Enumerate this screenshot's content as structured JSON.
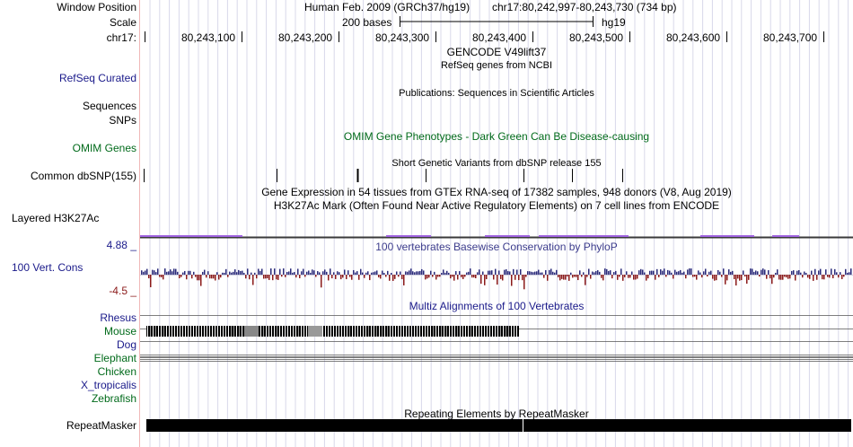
{
  "header": {
    "window_position_label": "Window Position",
    "scale_label": "Scale",
    "chrom_label": "chr17:",
    "assembly_text": "Human Feb. 2009 (GRCh37/hg19)",
    "position_text": "chr17:80,242,997-80,243,730 (734 bp)",
    "scale_text": "200 bases",
    "scale_db": "hg19",
    "coord_ticks": [
      "80,243,100",
      "80,243,200",
      "80,243,300",
      "80,243,400",
      "80,243,500",
      "80,243,600",
      "80,243,700"
    ]
  },
  "tracks": {
    "gencode_title": "GENCODE V49lift37",
    "refseq_subtitle": "RefSeq genes from NCBI",
    "refseq_label": "RefSeq Curated",
    "publications_title": "Publications: Sequences in Scientific Articles",
    "sequences_label": "Sequences",
    "snps_label": "SNPs",
    "omim_title": "OMIM Gene Phenotypes - Dark Green Can Be Disease-causing",
    "omim_label": "OMIM Genes",
    "dbsnp_title": "Short Genetic Variants from dbSNP release 155",
    "dbsnp_label": "Common dbSNP(155)",
    "gtex_title": "Gene Expression in 54 tissues from GTEx RNA-seq of 17382 samples, 948 donors (V8, Aug 2019)",
    "h3k27ac_title": "H3K27Ac Mark (Often Found Near Active Regulatory Elements) on 7 cell lines from ENCODE",
    "h3k27ac_label": "Layered H3K27Ac",
    "phylop_title": "100 vertebrates Basewise Conservation by PhyloP",
    "phylop_max": "4.88 _",
    "phylop_label": "100 Vert. Cons",
    "phylop_min": "-4.5 _",
    "multiz_title": "Multiz Alignments of 100 Vertebrates",
    "species": [
      "Rhesus",
      "Mouse",
      "Dog",
      "Elephant",
      "Chicken",
      "X_tropicalis",
      "Zebrafish"
    ],
    "repeat_title": "Repeating Elements by RepeatMasker",
    "repeat_label": "RepeatMasker"
  },
  "colors": {
    "gridline": "#d8d8ea",
    "side_line": "#f0b8b8",
    "navy": "#1a1a8a",
    "dark_green": "#006a1a",
    "phylop_pos": "#2a2a7a",
    "phylop_neg": "#8b1a1a",
    "h3k27ac": "#a064e0"
  },
  "icons": {
    "dbsnp_marker": "tick-mark"
  }
}
